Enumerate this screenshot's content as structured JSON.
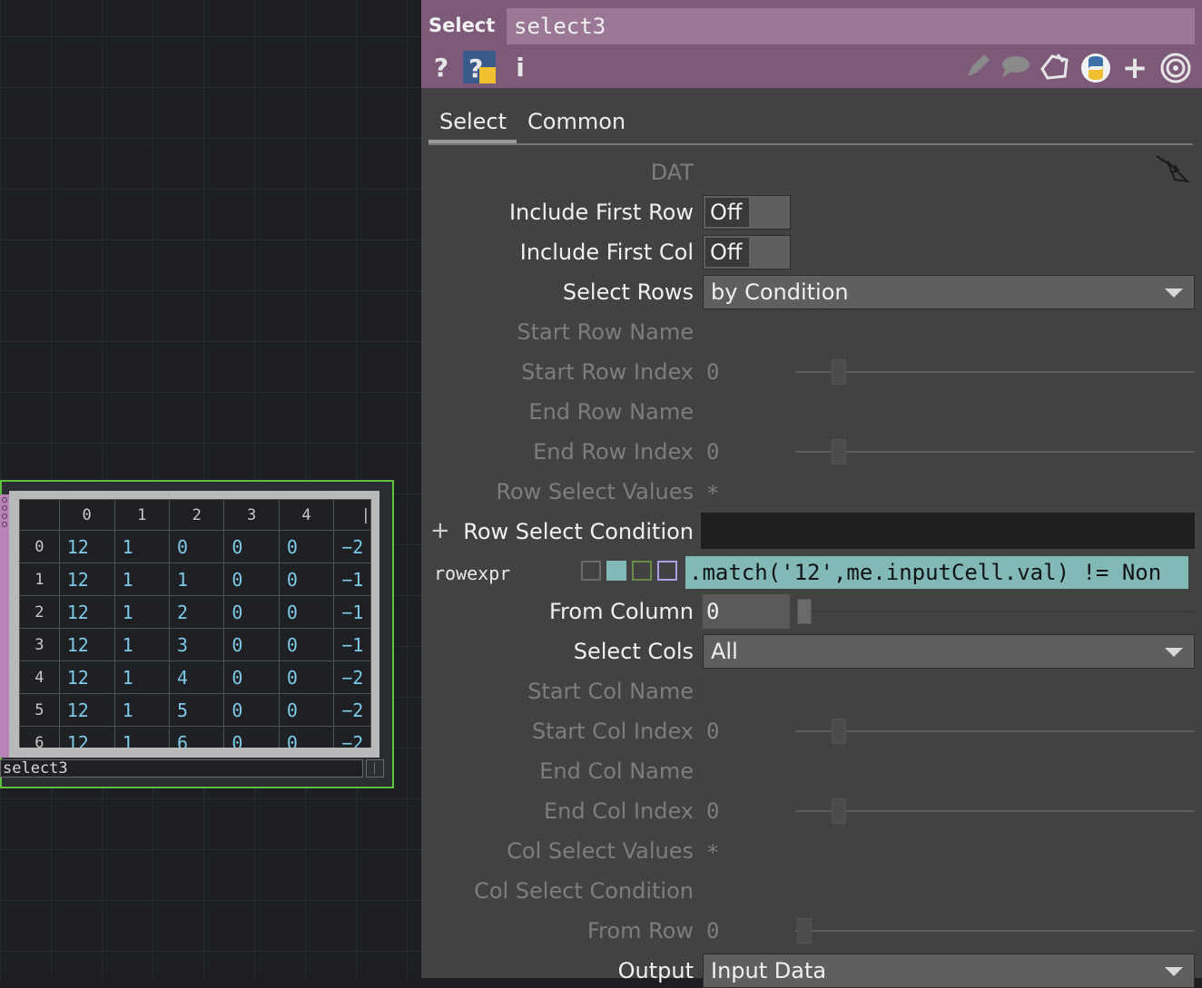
{
  "node": {
    "name": "select3",
    "col_headers": [
      "0",
      "1",
      "2",
      "3",
      "4",
      "|"
    ],
    "rows": [
      {
        "index": "0",
        "cells": [
          "12",
          "1",
          "0",
          "0",
          "0",
          "−2"
        ]
      },
      {
        "index": "1",
        "cells": [
          "12",
          "1",
          "1",
          "0",
          "0",
          "−1"
        ]
      },
      {
        "index": "2",
        "cells": [
          "12",
          "1",
          "2",
          "0",
          "0",
          "−1"
        ]
      },
      {
        "index": "3",
        "cells": [
          "12",
          "1",
          "3",
          "0",
          "0",
          "−1"
        ]
      },
      {
        "index": "4",
        "cells": [
          "12",
          "1",
          "4",
          "0",
          "0",
          "−2"
        ]
      },
      {
        "index": "5",
        "cells": [
          "12",
          "1",
          "5",
          "0",
          "0",
          "−2"
        ]
      },
      {
        "index": "6",
        "cells": [
          "12",
          "1",
          "6",
          "0",
          "0",
          "−2"
        ]
      }
    ]
  },
  "panel": {
    "op_type": "Select",
    "op_name": "select3",
    "header_icons": [
      "help-icon",
      "python-help-icon",
      "info-icon",
      "pencil-icon",
      "comment-icon",
      "clone-icon",
      "python-icon",
      "add-icon",
      "target-icon"
    ],
    "tabs": [
      "Select",
      "Common"
    ],
    "params": {
      "dat": "DAT",
      "include_first_row": {
        "label": "Include First Row",
        "value": "Off"
      },
      "include_first_col": {
        "label": "Include First Col",
        "value": "Off"
      },
      "select_rows": {
        "label": "Select Rows",
        "value": "by Condition"
      },
      "start_row_name": {
        "label": "Start Row Name"
      },
      "start_row_index": {
        "label": "Start Row Index",
        "value": "0"
      },
      "end_row_name": {
        "label": "End Row  Name"
      },
      "end_row_index": {
        "label": "End Row Index",
        "value": "0"
      },
      "row_select_values": {
        "label": "Row Select Values",
        "value": "*"
      },
      "row_select_condition": {
        "label": "Row Select Condition",
        "plus": "+"
      },
      "rowexpr": {
        "label": "rowexpr",
        "value": ".match('12',me.inputCell.val) != Non"
      },
      "from_column": {
        "label": "From Column",
        "value": "0"
      },
      "select_cols": {
        "label": "Select Cols",
        "value": "All"
      },
      "start_col_name": {
        "label": "Start Col Name"
      },
      "start_col_index": {
        "label": "Start Col Index",
        "value": "0"
      },
      "end_col_name": {
        "label": "End Col Name"
      },
      "end_col_index": {
        "label": "End Col Index",
        "value": "0"
      },
      "col_select_values": {
        "label": "Col Select Values",
        "value": "*"
      },
      "col_select_condition": {
        "label": "Col Select Condition"
      },
      "from_row": {
        "label": "From Row",
        "value": "0"
      },
      "output": {
        "label": "Output",
        "value": "Input Data"
      }
    }
  },
  "colors": {
    "header_bg": "#7d5a79",
    "node_border": "#5fbf3f",
    "expr_bg": "#82b9b6",
    "cell_text": "#7ec8e8"
  }
}
